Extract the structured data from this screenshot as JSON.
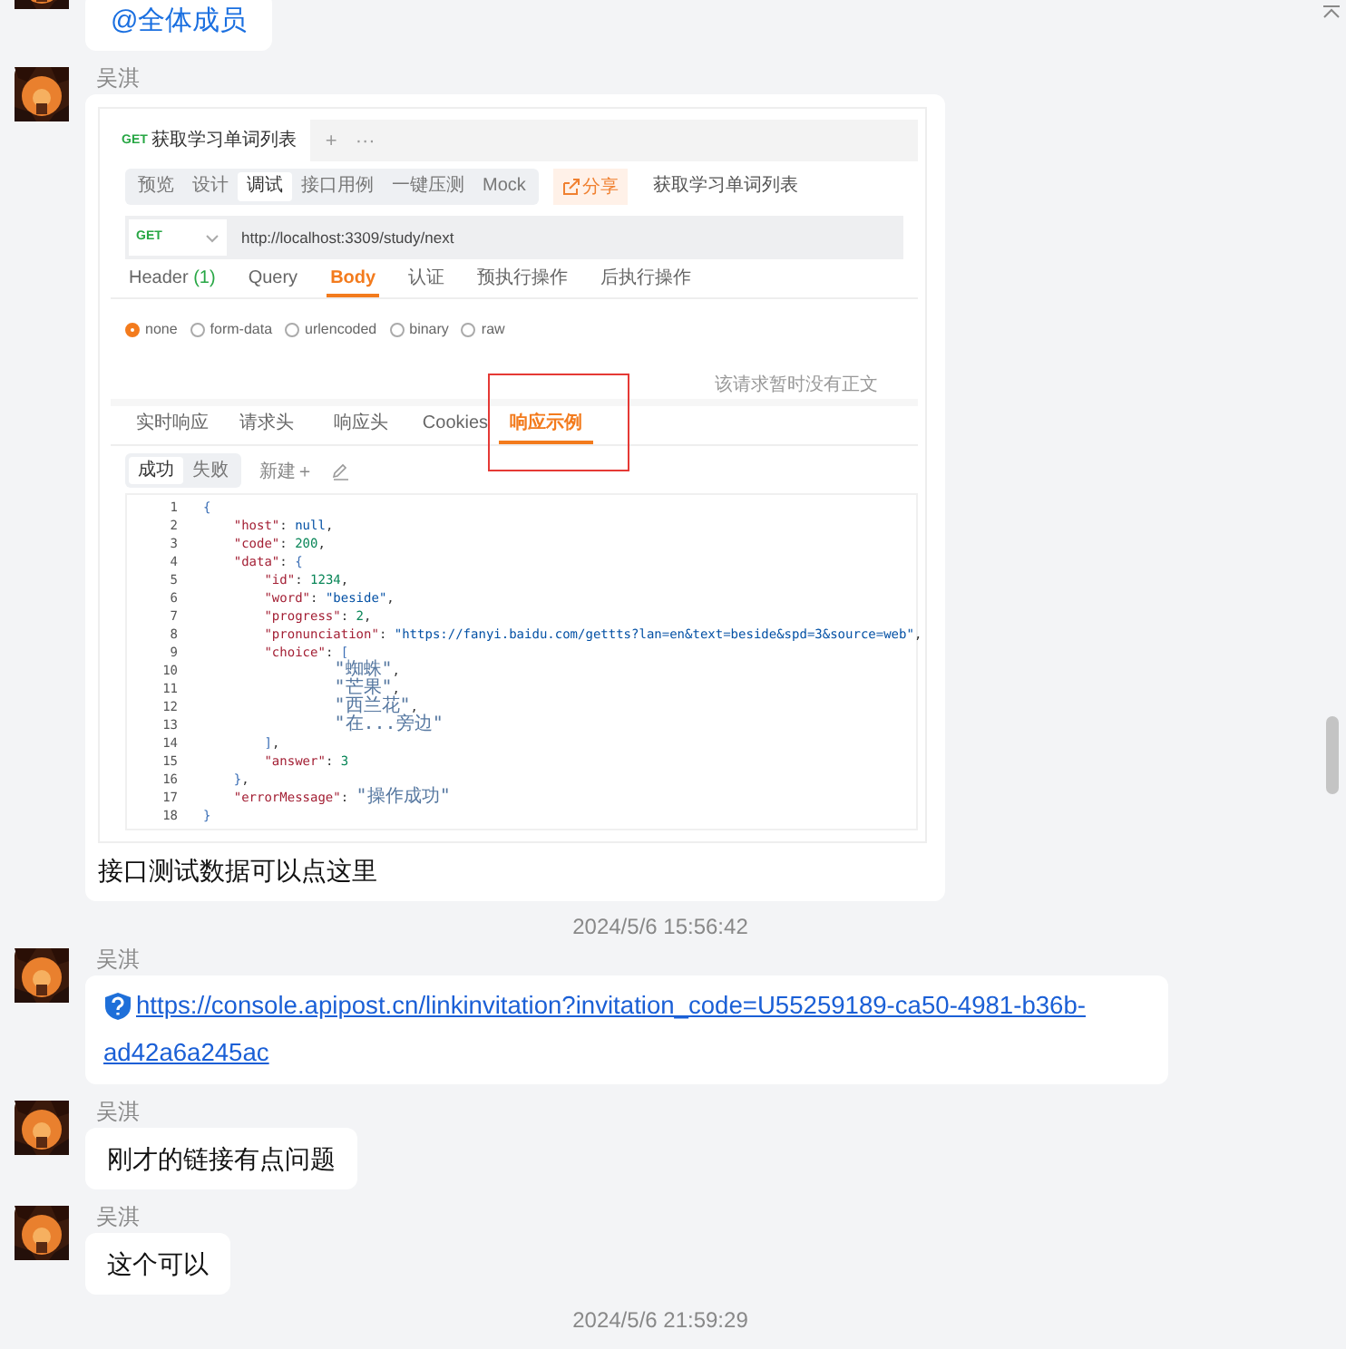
{
  "messages": [
    {
      "kind": "mention",
      "text": "@全体成员"
    },
    {
      "kind": "screenshot",
      "sender": "吴淇",
      "caption": "接口测试数据可以点这里",
      "screenshot": {
        "request_tab": {
          "method": "GET",
          "title": "获取学习单词列表"
        },
        "tab_actions": [
          "+",
          "···"
        ],
        "mode_tabs": [
          {
            "label": "预览",
            "selected": false
          },
          {
            "label": "设计",
            "selected": false
          },
          {
            "label": "调试",
            "selected": true
          },
          {
            "label": "接口用例",
            "selected": false
          },
          {
            "label": "一键压测",
            "selected": false
          },
          {
            "label": "Mock",
            "selected": false
          }
        ],
        "share_button": "分享",
        "api_name": "获取学习单词列表",
        "method_select": "GET",
        "url": "http://localhost:3309/study/next",
        "request_tabs": [
          {
            "label": "Header",
            "count": "(1)",
            "selected": false
          },
          {
            "label": "Query",
            "selected": false
          },
          {
            "label": "Body",
            "selected": true
          },
          {
            "label": "认证",
            "selected": false
          },
          {
            "label": "预执行操作",
            "selected": false
          },
          {
            "label": "后执行操作",
            "selected": false
          }
        ],
        "body_types": [
          {
            "label": "none",
            "selected": true
          },
          {
            "label": "form-data",
            "selected": false
          },
          {
            "label": "urlencoded",
            "selected": false
          },
          {
            "label": "binary",
            "selected": false
          },
          {
            "label": "raw",
            "selected": false
          }
        ],
        "empty_note": "该请求暂时没有正文",
        "response_tabs": [
          {
            "label": "实时响应",
            "selected": false,
            "highlighted": false
          },
          {
            "label": "请求头",
            "selected": false,
            "highlighted": false
          },
          {
            "label": "响应头",
            "selected": false,
            "highlighted": false
          },
          {
            "label": "Cookies",
            "selected": false,
            "highlighted": false
          },
          {
            "label": "响应示例",
            "selected": true,
            "highlighted": true
          }
        ],
        "example_tabs": [
          {
            "label": "成功",
            "selected": true
          },
          {
            "label": "失败",
            "selected": false
          }
        ],
        "new_button": "新建＋",
        "code_lines": [
          {
            "number": "1",
            "tokens": [
              {
                "kind": "bracket",
                "text": "{"
              }
            ]
          },
          {
            "number": "2",
            "tokens": [
              {
                "kind": "key",
                "text": "    \"host\""
              },
              {
                "kind": "punct",
                "text": ": "
              },
              {
                "kind": "literal",
                "text": "null"
              },
              {
                "kind": "punct",
                "text": ","
              }
            ]
          },
          {
            "number": "3",
            "tokens": [
              {
                "kind": "key",
                "text": "    \"code\""
              },
              {
                "kind": "punct",
                "text": ": "
              },
              {
                "kind": "number",
                "text": "200"
              },
              {
                "kind": "punct",
                "text": ","
              }
            ]
          },
          {
            "number": "4",
            "tokens": [
              {
                "kind": "key",
                "text": "    \"data\""
              },
              {
                "kind": "punct",
                "text": ": "
              },
              {
                "kind": "bracket",
                "text": "{"
              }
            ]
          },
          {
            "number": "5",
            "tokens": [
              {
                "kind": "key",
                "text": "        \"id\""
              },
              {
                "kind": "punct",
                "text": ": "
              },
              {
                "kind": "number",
                "text": "1234"
              },
              {
                "kind": "punct",
                "text": ","
              }
            ]
          },
          {
            "number": "6",
            "tokens": [
              {
                "kind": "key",
                "text": "        \"word\""
              },
              {
                "kind": "punct",
                "text": ": "
              },
              {
                "kind": "string",
                "text": "\"beside\""
              },
              {
                "kind": "punct",
                "text": ","
              }
            ]
          },
          {
            "number": "7",
            "tokens": [
              {
                "kind": "key",
                "text": "        \"progress\""
              },
              {
                "kind": "punct",
                "text": ": "
              },
              {
                "kind": "number",
                "text": "2"
              },
              {
                "kind": "punct",
                "text": ","
              }
            ]
          },
          {
            "number": "8",
            "tokens": [
              {
                "kind": "key",
                "text": "        \"pronunciation\""
              },
              {
                "kind": "punct",
                "text": ": "
              },
              {
                "kind": "string",
                "text": "\"https://fanyi.baidu.com/gettts?lan=en&text=beside&spd=3&source=web\""
              },
              {
                "kind": "punct",
                "text": ","
              }
            ]
          },
          {
            "number": "9",
            "tokens": [
              {
                "kind": "key",
                "text": "        \"choice\""
              },
              {
                "kind": "punct",
                "text": ": "
              },
              {
                "kind": "bracket",
                "text": "["
              }
            ]
          },
          {
            "number": "10",
            "tokens": [
              {
                "kind": "text",
                "text": "            \"蜘蛛\""
              },
              {
                "kind": "punct",
                "text": ","
              }
            ]
          },
          {
            "number": "11",
            "tokens": [
              {
                "kind": "text",
                "text": "            \"芒果\""
              },
              {
                "kind": "punct",
                "text": ","
              }
            ]
          },
          {
            "number": "12",
            "tokens": [
              {
                "kind": "text",
                "text": "            \"西兰花\""
              },
              {
                "kind": "punct",
                "text": ","
              }
            ]
          },
          {
            "number": "13",
            "tokens": [
              {
                "kind": "text",
                "text": "            \"在...旁边\""
              }
            ]
          },
          {
            "number": "14",
            "tokens": [
              {
                "kind": "bracket",
                "text": "        ]"
              },
              {
                "kind": "punct",
                "text": ","
              }
            ]
          },
          {
            "number": "15",
            "tokens": [
              {
                "kind": "key",
                "text": "        \"answer\""
              },
              {
                "kind": "punct",
                "text": ": "
              },
              {
                "kind": "number",
                "text": "3"
              }
            ]
          },
          {
            "number": "16",
            "tokens": [
              {
                "kind": "bracket",
                "text": "    }"
              },
              {
                "kind": "punct",
                "text": ","
              }
            ]
          },
          {
            "number": "17",
            "tokens": [
              {
                "kind": "key",
                "text": "    \"errorMessage\""
              },
              {
                "kind": "punct",
                "text": ": "
              },
              {
                "kind": "text",
                "text": "\"操作成功\""
              }
            ]
          },
          {
            "number": "18",
            "tokens": [
              {
                "kind": "bracket",
                "text": "}"
              }
            ]
          }
        ]
      }
    },
    {
      "kind": "time",
      "text": "2024/5/6 15:56:42"
    },
    {
      "kind": "link",
      "sender": "吴淇",
      "url": "https://console.apipost.cn/linkinvitation?invitation_code=U55259189-ca50-4981-b36b-ad42a6a245ac"
    },
    {
      "kind": "text",
      "sender": "吴淇",
      "text": "刚才的链接有点问题"
    },
    {
      "kind": "text",
      "sender": "吴淇",
      "text": "这个可以"
    },
    {
      "kind": "time",
      "text": "2024/5/6 21:59:29"
    }
  ]
}
